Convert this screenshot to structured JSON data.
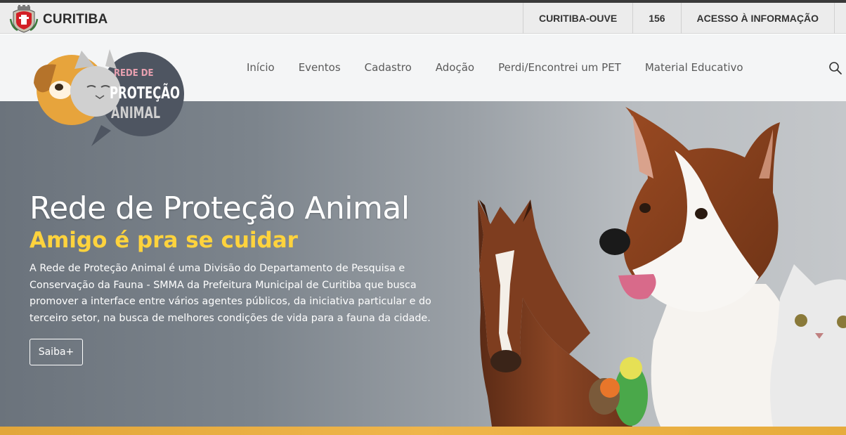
{
  "govbar": {
    "city": "CURITIBA",
    "links": [
      "CURITIBA-OUVE",
      "156",
      "ACESSO À INFORMAÇÃO"
    ]
  },
  "logo": {
    "line1": "REDE DE",
    "line2": "PROTEÇÃO",
    "line3": "ANIMAL"
  },
  "nav": {
    "items": [
      "Início",
      "Eventos",
      "Cadastro",
      "Adoção",
      "Perdi/Encontrei um PET",
      "Material Educativo"
    ],
    "search_icon": "search-icon"
  },
  "hero": {
    "title": "Rede de Proteção Animal",
    "subtitle": "Amigo é pra se cuidar",
    "description": "A Rede de Proteção Animal é uma Divisão do Departamento de Pesquisa e Conservação da Fauna - SMMA da Prefeitura Municipal de Curitiba que busca promover a interface entre vários agentes públicos, da iniciativa particular e do terceiro setor, na busca de melhores condições de vida para a fauna da cidade.",
    "button": "Saiba+"
  },
  "colors": {
    "subtitle": "#ffd33d",
    "accent_strip": "#efb54a",
    "logo_dark": "#4e5561"
  }
}
